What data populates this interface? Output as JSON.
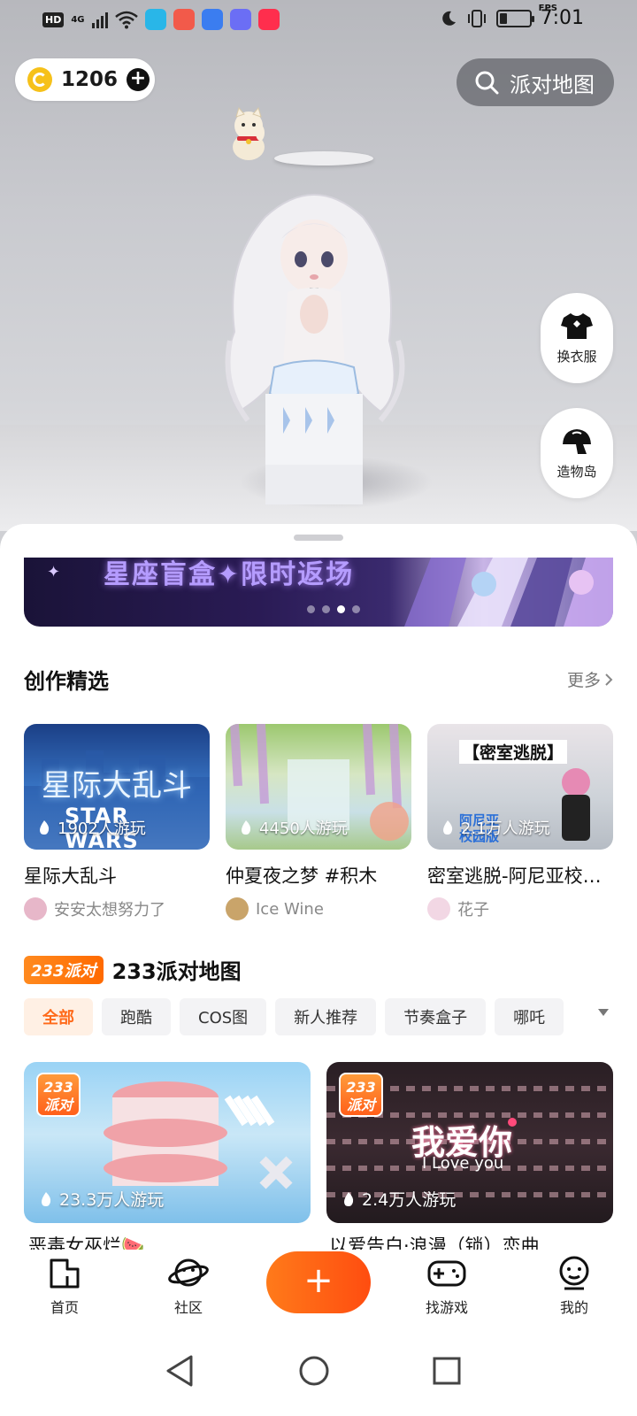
{
  "status_bar": {
    "network": "HD",
    "signal": "4G",
    "fps": "FPS",
    "time": "7:01"
  },
  "wallet": {
    "coins": "1206"
  },
  "search": {
    "label": "派对地图"
  },
  "side_buttons": {
    "wardrobe": "换衣服",
    "creation_island": "造物岛"
  },
  "banner": {
    "text": "星座盲盒✦限时返场",
    "page_count": 4,
    "active_index": 2
  },
  "featured": {
    "title": "创作精选",
    "more": "更多",
    "cards": [
      {
        "title": "星际大乱斗",
        "plays": "1902人游玩",
        "author": "安安太想努力了",
        "art_text": "星际大乱斗",
        "art_sub": "STAR WARS"
      },
      {
        "title": "仲夏夜之梦 #积木",
        "plays": "4450人游玩",
        "author": "Ice Wine"
      },
      {
        "title": "密室逃脱-阿尼亚校园版",
        "plays": "2.1万人游玩",
        "author": "花子",
        "art_text": "【密室逃脱】",
        "art_sub": "阿尼亚 校园版"
      }
    ]
  },
  "party_maps": {
    "badge": "233派对",
    "title": "233派对地图",
    "chips": [
      "全部",
      "跑酷",
      "COS图",
      "新人推荐",
      "节奏盒子",
      "哪吒"
    ],
    "active_chip": 0,
    "cards": [
      {
        "plays": "23.3万人游玩",
        "badge": "233派对",
        "title_peek": "恶毒女巫烂🍉"
      },
      {
        "plays": "2.4万人游玩",
        "badge": "233派对",
        "art_text": "我爱你",
        "art_sub": "I Love you",
        "title_peek": "以爱告白·浪漫（锁）恋曲"
      }
    ]
  },
  "bottom_nav": {
    "home": "首页",
    "community": "社区",
    "plus": "+",
    "find_games": "找游戏",
    "me": "我的"
  },
  "colors": {
    "accent": "#ff6a1a",
    "coin": "#f6c11a"
  }
}
